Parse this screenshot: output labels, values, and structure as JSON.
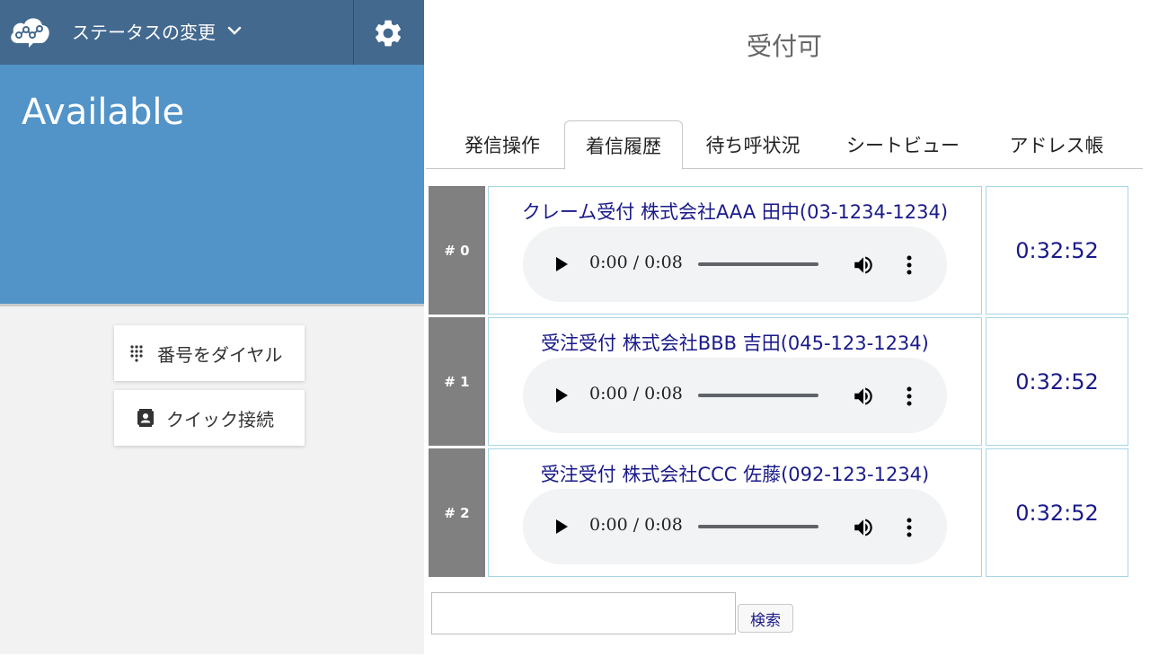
{
  "header": {
    "status_menu_label": "ステータスの変更",
    "logo_icon": "cloud-network-icon",
    "settings_icon": "gear-icon",
    "bar_color": "#43698f"
  },
  "status": {
    "label": "Available",
    "panel_color": "#5293c8"
  },
  "actions": {
    "dial_label": "番号をダイヤル",
    "dial_icon": "dialpad-icon",
    "quick_label": "クイック接続",
    "quick_icon": "contact-card-icon"
  },
  "main": {
    "title": "受付可",
    "tabs": [
      {
        "label": "発信操作",
        "active": false
      },
      {
        "label": "着信履歴",
        "active": true
      },
      {
        "label": "待ち呼状況",
        "active": false
      },
      {
        "label": "シートビュー",
        "active": false
      },
      {
        "label": "アドレス帳",
        "active": false
      }
    ],
    "history": [
      {
        "num": "# 0",
        "title": "クレーム受付 株式会社AAA 田中(03-1234-1234)",
        "player_time": "0:00 / 0:08",
        "duration": "0:32:52"
      },
      {
        "num": "# 1",
        "title": "受注受付 株式会社BBB 吉田(045-123-1234)",
        "player_time": "0:00 / 0:08",
        "duration": "0:32:52"
      },
      {
        "num": "# 2",
        "title": "受注受付 株式会社CCC 佐藤(092-123-1234)",
        "player_time": "0:00 / 0:08",
        "duration": "0:32:52"
      }
    ],
    "search": {
      "value": "",
      "button_label": "検索"
    }
  },
  "colors": {
    "link_text": "#1a1a8a",
    "row_number_bg": "#808080",
    "cell_border": "#a6d6e4"
  }
}
